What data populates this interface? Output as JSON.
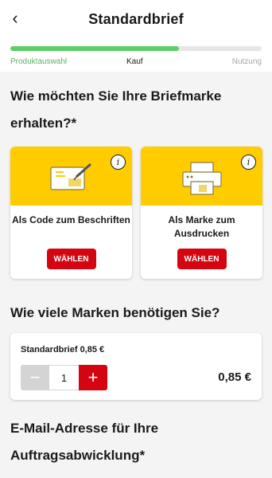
{
  "header": {
    "title": "Standardbrief",
    "back_icon": "chevron-left-icon"
  },
  "progress": {
    "fraction": 0.67,
    "fill_color": "#5fcd6a",
    "steps": [
      "Produktauswahl",
      "Kauf",
      "Nutzung"
    ]
  },
  "sections": {
    "delivery_title": "Wie möchten Sie Ihre Briefmarke erhalten?*",
    "quantity_title": "Wie viele Marken benötigen Sie?",
    "email_title": "E-Mail-Adresse für Ihre Auftragsabwicklung*"
  },
  "options": [
    {
      "label": "Als Code zum Beschriften",
      "button": "WÄHLEN",
      "icon": "write-code-icon",
      "info_icon": "info-icon"
    },
    {
      "label": "Als Marke zum Ausdrucken",
      "button": "WÄHLEN",
      "icon": "printer-icon",
      "info_icon": "info-icon"
    }
  ],
  "quantity": {
    "product_label": "Standardbrief 0,85 €",
    "value": "1",
    "minus": "−",
    "plus": "+",
    "total": "0,85 €"
  },
  "colors": {
    "accent_yellow": "#ffcc00",
    "accent_red": "#d40511"
  }
}
